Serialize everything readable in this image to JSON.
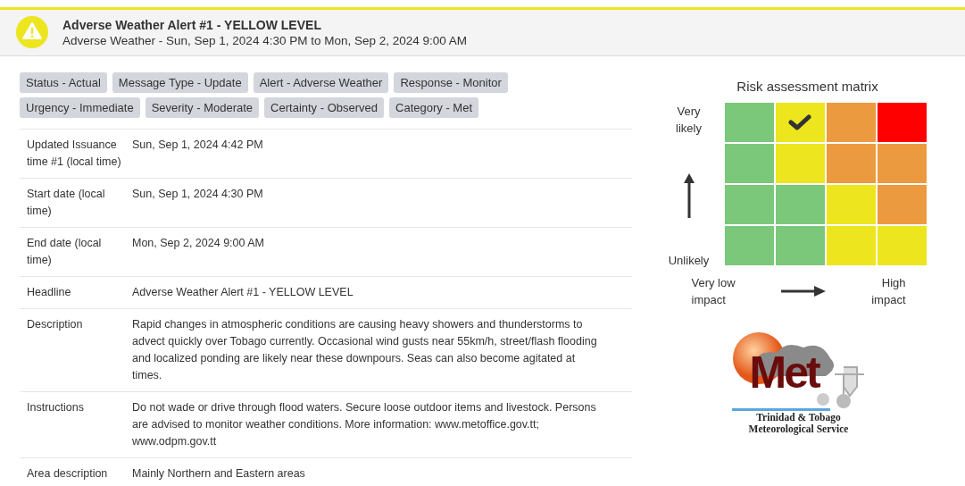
{
  "alert": {
    "color": "#ede51e",
    "title": "Adverse Weather Alert #1 - YELLOW LEVEL",
    "subtitle": "Adverse Weather - Sun, Sep 1, 2024 4:30 PM to Mon, Sep 2, 2024 9:00 AM"
  },
  "tags": [
    "Status - Actual",
    "Message Type - Update",
    "Alert - Adverse Weather",
    "Response - Monitor",
    "Urgency - Immediate",
    "Severity - Moderate",
    "Certainty - Observed",
    "Category - Met"
  ],
  "details": [
    {
      "label": "Updated Issuance time #1 (local time)",
      "value": "Sun, Sep 1, 2024 4:42 PM"
    },
    {
      "label": "Start date (local time)",
      "value": "Sun, Sep 1, 2024 4:30 PM"
    },
    {
      "label": "End date (local time)",
      "value": "Mon, Sep 2, 2024 9:00 AM"
    },
    {
      "label": "Headline",
      "value": "Adverse Weather Alert #1 - YELLOW LEVEL"
    },
    {
      "label": "Description",
      "value": "Rapid changes in atmospheric conditions are causing heavy showers and thunderstorms to advect quickly over Tobago currently. Occasional wind gusts near 55km/h, street/flash flooding and localized ponding are likely near these downpours. Seas can also become agitated at times."
    },
    {
      "label": "Instructions",
      "value": "Do not wade or drive through flood waters. Secure loose outdoor items and livestock. Persons are advised to monitor weather conditions. More information: www.metoffice.gov.tt; www.odpm.gov.tt"
    },
    {
      "label": "Area description",
      "value": "Mainly Northern and Eastern areas"
    }
  ],
  "risk_matrix": {
    "title": "Risk assessment matrix",
    "y_top": "Very likely",
    "y_bottom": "Unlikely",
    "x_left": "Very low impact",
    "x_right": "High impact",
    "rows": [
      [
        {
          "color": "#7bc87a",
          "selected": false
        },
        {
          "color": "#ede51e",
          "selected": true
        },
        {
          "color": "#ec9a40",
          "selected": false
        },
        {
          "color": "#fe0000",
          "selected": false
        }
      ],
      [
        {
          "color": "#7bc87a",
          "selected": false
        },
        {
          "color": "#ede51e",
          "selected": false
        },
        {
          "color": "#ec9a40",
          "selected": false
        },
        {
          "color": "#ec9a40",
          "selected": false
        }
      ],
      [
        {
          "color": "#7bc87a",
          "selected": false
        },
        {
          "color": "#7bc87a",
          "selected": false
        },
        {
          "color": "#ede51e",
          "selected": false
        },
        {
          "color": "#ec9a40",
          "selected": false
        }
      ],
      [
        {
          "color": "#7bc87a",
          "selected": false
        },
        {
          "color": "#7bc87a",
          "selected": false
        },
        {
          "color": "#ede51e",
          "selected": false
        },
        {
          "color": "#ede51e",
          "selected": false
        }
      ]
    ]
  },
  "logo": {
    "mark": "Met",
    "line_1": "Trinidad & Tobago",
    "line_2": "Meteorological Service"
  }
}
